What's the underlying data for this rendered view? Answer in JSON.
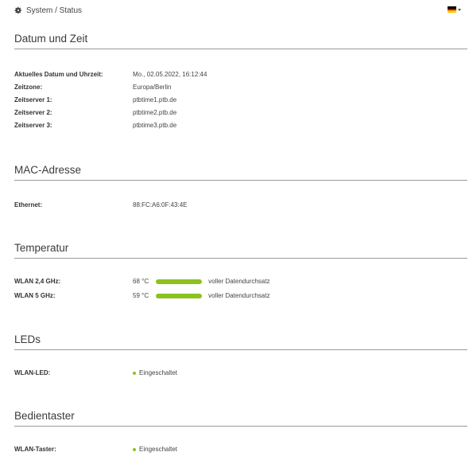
{
  "breadcrumb": {
    "icon": "gear-icon",
    "text": "System / Status"
  },
  "language": {
    "flag": "germany-flag-icon"
  },
  "sections": {
    "datetime": {
      "title": "Datum und Zeit",
      "rows": [
        {
          "label": "Aktuelles Datum und Uhrzeit:",
          "value": "Mo., 02.05.2022, 16:12:44"
        },
        {
          "label": "Zeitzone:",
          "value": "Europa/Berlin"
        },
        {
          "label": "Zeitserver 1:",
          "value": "ptbtime1.ptb.de"
        },
        {
          "label": "Zeitserver 2:",
          "value": "ptbtime2.ptb.de"
        },
        {
          "label": "Zeitserver 3:",
          "value": "ptbtime3.ptb.de"
        }
      ]
    },
    "mac": {
      "title": "MAC-Adresse",
      "rows": [
        {
          "label": "Ethernet:",
          "value": "88:FC:A6:0F:43:4E"
        }
      ]
    },
    "temperature": {
      "title": "Temperatur",
      "rows": [
        {
          "label": "WLAN 2,4 GHz:",
          "value": "68 °C",
          "status": "voller Datendurchsatz"
        },
        {
          "label": "WLAN 5 GHz:",
          "value": "59 °C",
          "status": "voller Datendurchsatz"
        }
      ]
    },
    "leds": {
      "title": "LEDs",
      "rows": [
        {
          "label": "WLAN-LED:",
          "value": "Eingeschaltet"
        }
      ]
    },
    "buttons": {
      "title": "Bedientaster",
      "rows": [
        {
          "label": "WLAN-Taster:",
          "value": "Eingeschaltet"
        }
      ]
    }
  },
  "colors": {
    "accent_green": "#8cc21f",
    "divider": "#9a9a9a"
  }
}
